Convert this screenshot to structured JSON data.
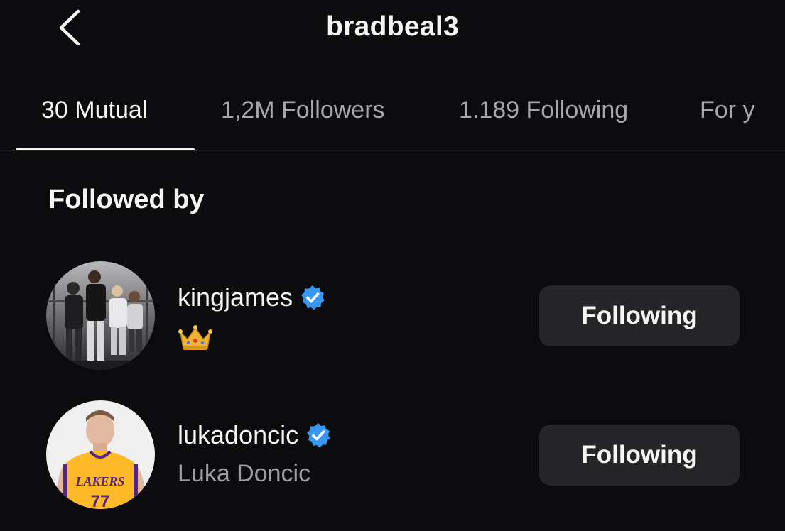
{
  "header": {
    "title": "bradbeal3"
  },
  "tabs": [
    {
      "label": "30 Mutual",
      "active": true
    },
    {
      "label": "1,2M Followers",
      "active": false
    },
    {
      "label": "1.189 Following",
      "active": false
    },
    {
      "label": "For y",
      "active": false
    }
  ],
  "section": {
    "title": "Followed by"
  },
  "accounts": [
    {
      "username": "kingjames",
      "verified": true,
      "subtitle": "",
      "subtitle_icon": "crown-emoji",
      "button_label": "Following"
    },
    {
      "username": "lukadoncic",
      "verified": true,
      "subtitle": "Luka Doncic",
      "button_label": "Following",
      "avatar_jersey_text": "LAKERS",
      "avatar_jersey_number": "77"
    }
  ],
  "colors": {
    "background": "#0c0c0e",
    "text_primary": "#f5f5f5",
    "text_secondary": "#9d9da1",
    "button_bg": "#262629",
    "verified_blue": "#3897f0",
    "crown_gold": "#f2b233",
    "jersey_yellow": "#fdb927",
    "jersey_purple": "#552583"
  }
}
